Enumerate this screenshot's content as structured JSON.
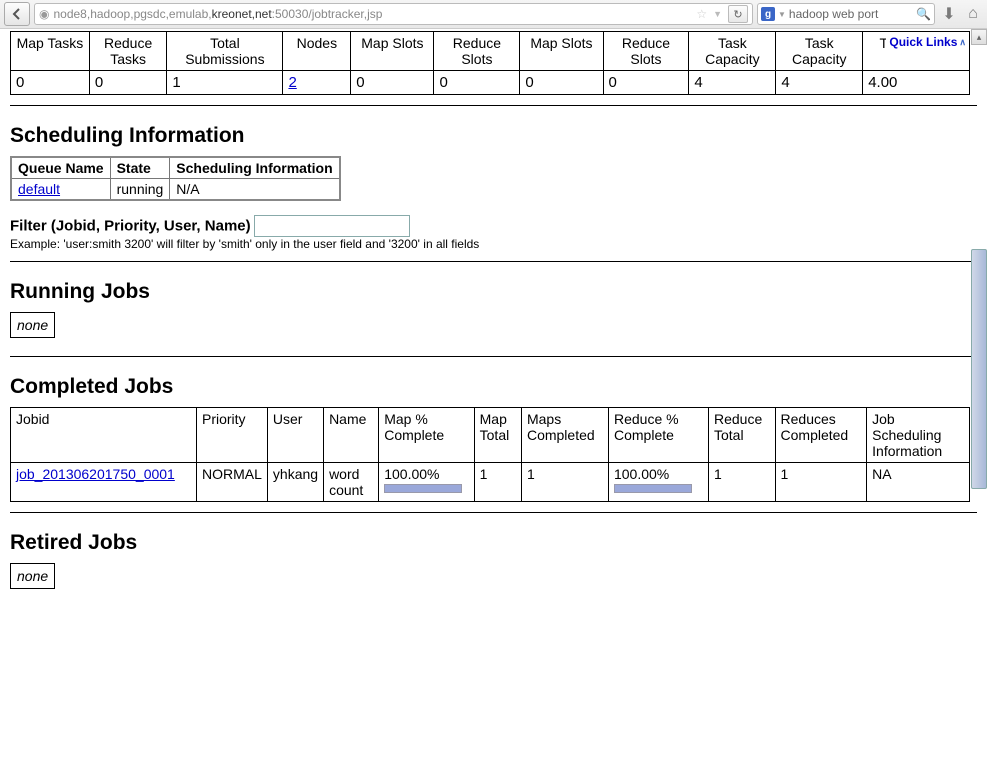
{
  "browser": {
    "url_pre": "node8,hadoop,pgsdc,emulab,",
    "url_hl": "kreonet,net",
    "url_post": ":50030/jobtracker,jsp",
    "search_engine": "g",
    "search_text": "hadoop web port",
    "quick_links": "Quick Links"
  },
  "cluster": {
    "headers": [
      "Map Tasks",
      "Reduce Tasks",
      "Total Submissions",
      "Nodes",
      "Map Slots",
      "Reduce Slots",
      "Map Slots",
      "Reduce Slots",
      "Task Capacity",
      "Task Capacity",
      "Tasks/Node"
    ],
    "row": [
      "0",
      "0",
      "1",
      "2",
      "0",
      "0",
      "0",
      "0",
      "4",
      "4",
      "4.00"
    ],
    "nodes_link_col": 3
  },
  "sched_heading": "Scheduling Information",
  "sched": {
    "headers": [
      "Queue Name",
      "State",
      "Scheduling Information"
    ],
    "row": {
      "queue": "default",
      "state": "running",
      "info": "N/A"
    }
  },
  "filter": {
    "label": "Filter (Jobid, Priority, User, Name)",
    "value": "",
    "example": "Example: 'user:smith 3200' will filter by 'smith' only in the user field and '3200' in all fields"
  },
  "running_heading": "Running Jobs",
  "none_label": "none",
  "completed_heading": "Completed Jobs",
  "completed": {
    "headers": [
      "Jobid",
      "Priority",
      "User",
      "Name",
      "Map % Complete",
      "Map Total",
      "Maps Completed",
      "Reduce % Complete",
      "Reduce Total",
      "Reduces Completed",
      "Job Scheduling Information"
    ],
    "row": {
      "jobid": "job_201306201750_0001",
      "priority": "NORMAL",
      "user": "yhkang",
      "name": "word count",
      "map_pct": "100.00%",
      "map_total": "1",
      "maps_completed": "1",
      "reduce_pct": "100.00%",
      "reduce_total": "1",
      "reduces_completed": "1",
      "sched_info": "NA"
    }
  },
  "retired_heading": "Retired Jobs"
}
